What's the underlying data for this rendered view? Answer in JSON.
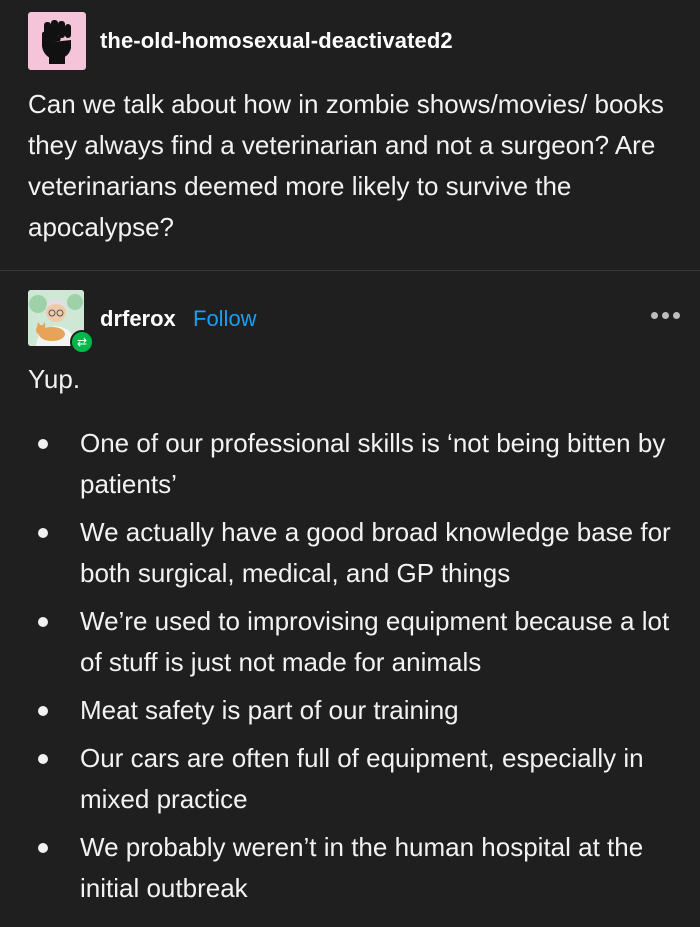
{
  "op_post": {
    "username": "the-old-homosexual-deactivated2",
    "avatar_icon": "raised-fist-icon",
    "avatar_bg": "#f6c4d8",
    "text": "Can we talk about how in zombie shows/movies/ books they always find a veterinarian and not a surgeon? Are veterinarians deemed more likely to survive the apocalypse?"
  },
  "reply": {
    "username": "drferox",
    "follow_label": "Follow",
    "follow_color": "#1a9ef0",
    "avatar_icon": "vet-with-cat-avatar",
    "badge_icon": "reblog-icon",
    "badge_color": "#00b84a",
    "more_icon": "more-options-icon",
    "intro": "Yup.",
    "bullets": [
      "One of our professional skills is ‘not being bitten by patients’",
      "We actually have a good broad knowledge base for both surgical, medical, and GP things",
      "We’re used to improvising equipment because a lot of stuff is just not made for animals",
      "Meat safety is part of our training",
      "Our cars are often full of equipment, especially in mixed practice",
      "We probably weren’t in the human hospital at the initial outbreak"
    ]
  }
}
